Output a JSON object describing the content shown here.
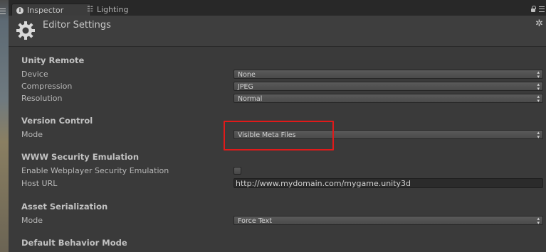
{
  "tabs": [
    {
      "label": "Inspector",
      "icon": "info-icon",
      "active": true
    },
    {
      "label": "Lighting",
      "icon": "lighting-icon",
      "active": false
    }
  ],
  "header": {
    "title": "Editor Settings",
    "icon": "gear-icon",
    "settings_icon": "settings-gear-icon"
  },
  "sections": {
    "unity_remote": {
      "title": "Unity Remote",
      "device": {
        "label": "Device",
        "value": "None"
      },
      "compression": {
        "label": "Compression",
        "value": "JPEG"
      },
      "resolution": {
        "label": "Resolution",
        "value": "Normal"
      }
    },
    "version_control": {
      "title": "Version Control",
      "mode": {
        "label": "Mode",
        "value": "Visible Meta Files"
      }
    },
    "www_security": {
      "title": "WWW Security Emulation",
      "enable": {
        "label": "Enable Webplayer Security Emulation",
        "checked": false
      },
      "host_url": {
        "label": "Host URL",
        "value": "http://www.mydomain.com/mygame.unity3d"
      }
    },
    "asset_serialization": {
      "title": "Asset Serialization",
      "mode": {
        "label": "Mode",
        "value": "Force Text"
      }
    },
    "default_behavior": {
      "title": "Default Behavior Mode"
    }
  },
  "colors": {
    "panel_bg": "#3a3a3a",
    "highlight": "#e11a1a"
  }
}
